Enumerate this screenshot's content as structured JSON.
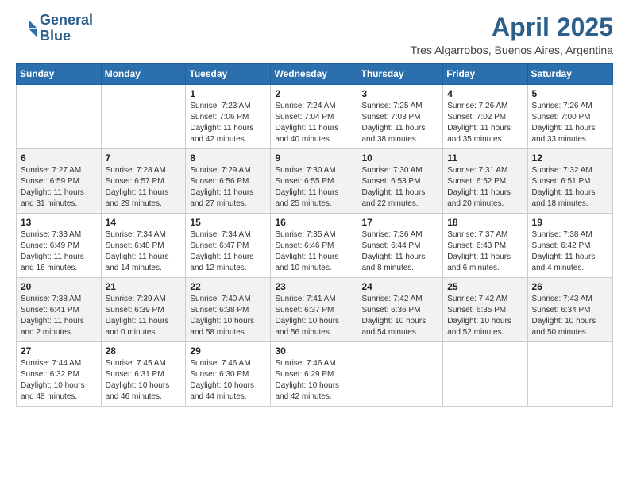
{
  "header": {
    "logo_line1": "General",
    "logo_line2": "Blue",
    "title": "April 2025",
    "subtitle": "Tres Algarrobos, Buenos Aires, Argentina"
  },
  "columns": [
    "Sunday",
    "Monday",
    "Tuesday",
    "Wednesday",
    "Thursday",
    "Friday",
    "Saturday"
  ],
  "weeks": [
    {
      "days": [
        {
          "num": "",
          "info": ""
        },
        {
          "num": "",
          "info": ""
        },
        {
          "num": "1",
          "info": "Sunrise: 7:23 AM\nSunset: 7:06 PM\nDaylight: 11 hours and 42 minutes."
        },
        {
          "num": "2",
          "info": "Sunrise: 7:24 AM\nSunset: 7:04 PM\nDaylight: 11 hours and 40 minutes."
        },
        {
          "num": "3",
          "info": "Sunrise: 7:25 AM\nSunset: 7:03 PM\nDaylight: 11 hours and 38 minutes."
        },
        {
          "num": "4",
          "info": "Sunrise: 7:26 AM\nSunset: 7:02 PM\nDaylight: 11 hours and 35 minutes."
        },
        {
          "num": "5",
          "info": "Sunrise: 7:26 AM\nSunset: 7:00 PM\nDaylight: 11 hours and 33 minutes."
        }
      ],
      "shaded": false
    },
    {
      "days": [
        {
          "num": "6",
          "info": "Sunrise: 7:27 AM\nSunset: 6:59 PM\nDaylight: 11 hours and 31 minutes."
        },
        {
          "num": "7",
          "info": "Sunrise: 7:28 AM\nSunset: 6:57 PM\nDaylight: 11 hours and 29 minutes."
        },
        {
          "num": "8",
          "info": "Sunrise: 7:29 AM\nSunset: 6:56 PM\nDaylight: 11 hours and 27 minutes."
        },
        {
          "num": "9",
          "info": "Sunrise: 7:30 AM\nSunset: 6:55 PM\nDaylight: 11 hours and 25 minutes."
        },
        {
          "num": "10",
          "info": "Sunrise: 7:30 AM\nSunset: 6:53 PM\nDaylight: 11 hours and 22 minutes."
        },
        {
          "num": "11",
          "info": "Sunrise: 7:31 AM\nSunset: 6:52 PM\nDaylight: 11 hours and 20 minutes."
        },
        {
          "num": "12",
          "info": "Sunrise: 7:32 AM\nSunset: 6:51 PM\nDaylight: 11 hours and 18 minutes."
        }
      ],
      "shaded": true
    },
    {
      "days": [
        {
          "num": "13",
          "info": "Sunrise: 7:33 AM\nSunset: 6:49 PM\nDaylight: 11 hours and 16 minutes."
        },
        {
          "num": "14",
          "info": "Sunrise: 7:34 AM\nSunset: 6:48 PM\nDaylight: 11 hours and 14 minutes."
        },
        {
          "num": "15",
          "info": "Sunrise: 7:34 AM\nSunset: 6:47 PM\nDaylight: 11 hours and 12 minutes."
        },
        {
          "num": "16",
          "info": "Sunrise: 7:35 AM\nSunset: 6:46 PM\nDaylight: 11 hours and 10 minutes."
        },
        {
          "num": "17",
          "info": "Sunrise: 7:36 AM\nSunset: 6:44 PM\nDaylight: 11 hours and 8 minutes."
        },
        {
          "num": "18",
          "info": "Sunrise: 7:37 AM\nSunset: 6:43 PM\nDaylight: 11 hours and 6 minutes."
        },
        {
          "num": "19",
          "info": "Sunrise: 7:38 AM\nSunset: 6:42 PM\nDaylight: 11 hours and 4 minutes."
        }
      ],
      "shaded": false
    },
    {
      "days": [
        {
          "num": "20",
          "info": "Sunrise: 7:38 AM\nSunset: 6:41 PM\nDaylight: 11 hours and 2 minutes."
        },
        {
          "num": "21",
          "info": "Sunrise: 7:39 AM\nSunset: 6:39 PM\nDaylight: 11 hours and 0 minutes."
        },
        {
          "num": "22",
          "info": "Sunrise: 7:40 AM\nSunset: 6:38 PM\nDaylight: 10 hours and 58 minutes."
        },
        {
          "num": "23",
          "info": "Sunrise: 7:41 AM\nSunset: 6:37 PM\nDaylight: 10 hours and 56 minutes."
        },
        {
          "num": "24",
          "info": "Sunrise: 7:42 AM\nSunset: 6:36 PM\nDaylight: 10 hours and 54 minutes."
        },
        {
          "num": "25",
          "info": "Sunrise: 7:42 AM\nSunset: 6:35 PM\nDaylight: 10 hours and 52 minutes."
        },
        {
          "num": "26",
          "info": "Sunrise: 7:43 AM\nSunset: 6:34 PM\nDaylight: 10 hours and 50 minutes."
        }
      ],
      "shaded": true
    },
    {
      "days": [
        {
          "num": "27",
          "info": "Sunrise: 7:44 AM\nSunset: 6:32 PM\nDaylight: 10 hours and 48 minutes."
        },
        {
          "num": "28",
          "info": "Sunrise: 7:45 AM\nSunset: 6:31 PM\nDaylight: 10 hours and 46 minutes."
        },
        {
          "num": "29",
          "info": "Sunrise: 7:46 AM\nSunset: 6:30 PM\nDaylight: 10 hours and 44 minutes."
        },
        {
          "num": "30",
          "info": "Sunrise: 7:46 AM\nSunset: 6:29 PM\nDaylight: 10 hours and 42 minutes."
        },
        {
          "num": "",
          "info": ""
        },
        {
          "num": "",
          "info": ""
        },
        {
          "num": "",
          "info": ""
        }
      ],
      "shaded": false
    }
  ]
}
